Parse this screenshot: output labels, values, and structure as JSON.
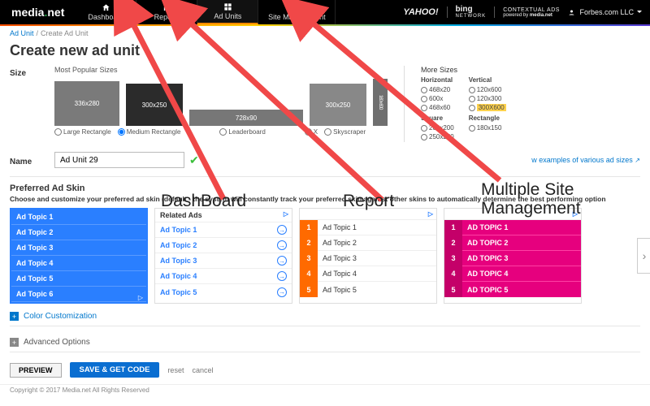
{
  "brand": {
    "name": "media",
    "suffix": "net"
  },
  "nav": {
    "items": [
      {
        "label": "Dashboard"
      },
      {
        "label": "Reports"
      },
      {
        "label": "Ad Units"
      },
      {
        "label": "Site Management"
      }
    ]
  },
  "partner": {
    "y": "YAHOO!",
    "b": "bing",
    "net": "NETWORK",
    "ctx1": "CONTEXTUAL ADS",
    "ctx2": "powered by",
    "ctx3": "media.net"
  },
  "user": {
    "name": "Forbes.com LLC"
  },
  "crumb": {
    "a": "Ad Unit",
    "b": "Create Ad Unit"
  },
  "title": "Create new ad unit",
  "size": {
    "label": "Size",
    "popular_h": "Most Popular Sizes",
    "b336": "336x280",
    "b300": "300x250",
    "b728": "728x90",
    "b300b": "300x250",
    "b160": "160 x 600",
    "r1": "Large Rectangle",
    "r2": "Medium Rectangle",
    "r3": "Leaderboard",
    "r4": "X",
    "r5": "Skyscraper",
    "more_h": "More Sizes",
    "horiz": "Horizontal",
    "vert": "Vertical",
    "sq": "Square",
    "rect": "Rectangle",
    "h1": "468x20",
    "h2": "600x",
    "h3": "468x60",
    "v1": "120x600",
    "v2": "120x300",
    "v3": "300X600",
    "s1": "200x200",
    "s2": "250x250",
    "re1": "180x150"
  },
  "name": {
    "label": "Name",
    "value": "Ad Unit 29"
  },
  "examples": {
    "text": "w examples of various ad sizes",
    "icon": "↗"
  },
  "skin": {
    "h": "Preferred Ad Skin",
    "p": "Choose and customize your preferred ad skin (default - the system will constantly track your preferred skin against other skins to automatically determine the best performing option",
    "hdr2": "Related Ads",
    "t": [
      "Ad Topic 1",
      "Ad Topic 2",
      "Ad Topic 3",
      "Ad Topic 4",
      "Ad Topic 5",
      "Ad Topic 6"
    ],
    "t5": [
      "Ad Topic 1",
      "Ad Topic 2",
      "Ad Topic 3",
      "Ad Topic 4",
      "Ad Topic 5"
    ],
    "T5": [
      "AD TOPIC 1",
      "AD TOPIC 2",
      "AD TOPIC 3",
      "AD TOPIC 4",
      "AD TOPIC 5"
    ]
  },
  "acc1": "Color Customization",
  "acc2": "Advanced Options",
  "btn": {
    "preview": "PREVIEW",
    "save": "SAVE & GET CODE",
    "reset": "reset",
    "cancel": "cancel"
  },
  "foot": "Copyright © 2017 Media.net All Rights Reserved",
  "anno": {
    "a": "DashBoard",
    "b": "Report",
    "c1": "Multiple Site",
    "c2": "Management"
  }
}
